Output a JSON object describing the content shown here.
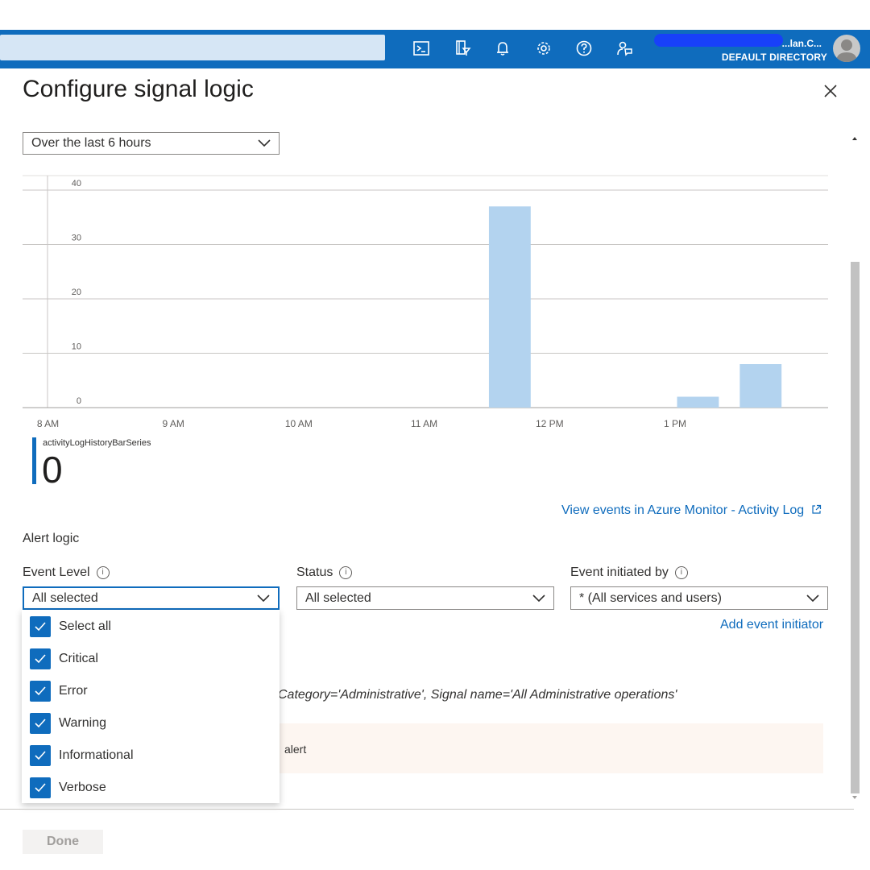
{
  "header": {
    "user_name": "...lan.C...",
    "directory": "DEFAULT DIRECTORY",
    "icons": [
      "cloud-shell-icon",
      "directory-filter-icon",
      "notifications-icon",
      "settings-icon",
      "help-icon",
      "feedback-icon"
    ]
  },
  "panel": {
    "title": "Configure signal logic",
    "time_range": "Over the last 6 hours"
  },
  "chart_data": {
    "type": "bar",
    "x_tick_labels": [
      "8 AM",
      "9 AM",
      "10 AM",
      "11 AM",
      "12 PM",
      "1 PM"
    ],
    "y_tick_labels": [
      "40",
      "30",
      "20",
      "10",
      "0"
    ],
    "ylim": [
      0,
      40
    ],
    "bars": [
      {
        "slot": "11:30 AM",
        "value": 37
      },
      {
        "slot": "1:00 PM",
        "value": 2
      },
      {
        "slot": "1:30 PM",
        "value": 8
      }
    ],
    "bar_color": "#b3d3ef",
    "series_name": "activityLogHistoryBarSeries",
    "series_value": "0"
  },
  "links": {
    "view_events": "View events in Azure Monitor - Activity Log",
    "add_initiator": "Add event initiator"
  },
  "alert_logic": {
    "heading": "Alert logic",
    "event_level": {
      "label": "Event Level",
      "value": "All selected"
    },
    "status": {
      "label": "Status",
      "value": "All selected"
    },
    "initiated_by": {
      "label": "Event initiated by",
      "value": "* (All services and users)"
    },
    "options": [
      "Select all",
      "Critical",
      "Error",
      "Warning",
      "Informational",
      "Verbose"
    ]
  },
  "condition_text": "Category='Administrative', Signal name='All Administrative operations'",
  "warning_text": "alert",
  "footer": {
    "done_label": "Done"
  },
  "colors": {
    "accent": "#0f6cbd",
    "bar": "#b3d3ef"
  }
}
